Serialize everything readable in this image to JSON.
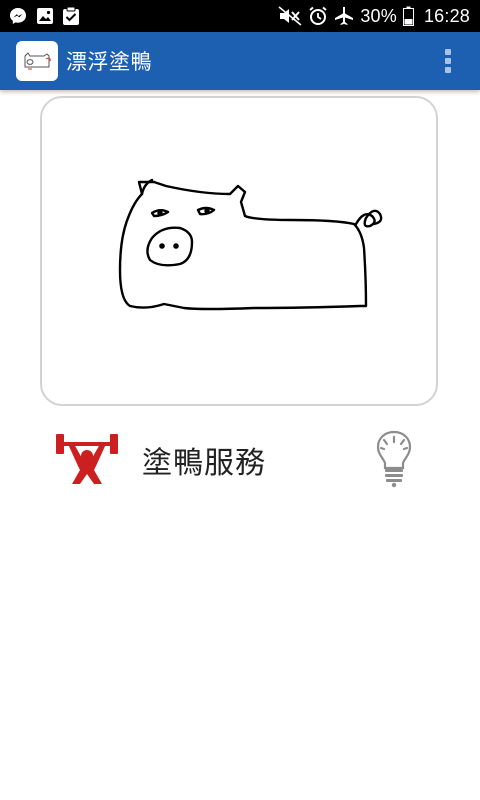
{
  "status_bar": {
    "battery": "30%",
    "time": "16:28",
    "icons": [
      "messenger-icon",
      "gallery-icon",
      "clipboard-check-icon",
      "mute-icon",
      "alarm-icon",
      "airplane-mode-icon",
      "battery-icon"
    ]
  },
  "app_bar": {
    "title": "漂浮塗鴨",
    "menu_icon": "overflow-menu-icon"
  },
  "drawing": {
    "subject": "pig-doodle"
  },
  "service": {
    "label": "塗鴨服務",
    "left_icon": "weightlifter-icon",
    "right_icon": "lightbulb-icon",
    "accent_color": "#cc1f1f",
    "bulb_color": "#8c8c8c"
  },
  "colors": {
    "app_bar": "#1d5fb0",
    "status_bar": "#000000"
  }
}
